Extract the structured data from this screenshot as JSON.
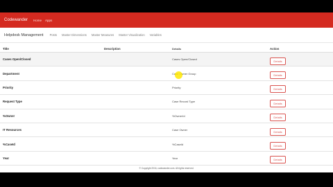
{
  "navbar": {
    "brand": "Codewander",
    "links": [
      "Home",
      "Apps"
    ]
  },
  "subnav": {
    "title": "Helpdesk Management",
    "links": [
      "Posts",
      "Master Dimensions",
      "Master Measures",
      "Master Visualization",
      "Variables"
    ]
  },
  "table": {
    "headers": {
      "title": "Title",
      "description": "Description",
      "details": "Details",
      "action": "Action"
    },
    "rows": [
      {
        "title": "Cases Open/Closed",
        "description": "",
        "details": "Cases Open/Closed",
        "action": "Details"
      },
      {
        "title": "Department",
        "description": "",
        "details": "Case Owner Group",
        "action": "Details"
      },
      {
        "title": "Priority",
        "description": "",
        "details": "Priority",
        "action": "Details"
      },
      {
        "title": "Request Type",
        "description": "",
        "details": "Case Record Type",
        "action": "Details"
      },
      {
        "title": "%Owner",
        "description": "",
        "details": "%OwnerId",
        "action": "Details"
      },
      {
        "title": "IT Resources",
        "description": "",
        "details": "Case Owner",
        "action": "Details"
      },
      {
        "title": "%CaseId",
        "description": "",
        "details": "%CaseId",
        "action": "Details"
      },
      {
        "title": "Year",
        "description": "",
        "details": "Year",
        "action": "Details"
      }
    ]
  },
  "footer": {
    "text": "© Copyright 2016, codewander.com. All rights reserved."
  },
  "colors": {
    "navbar": "#d42a20",
    "button_border": "#d9534f"
  }
}
